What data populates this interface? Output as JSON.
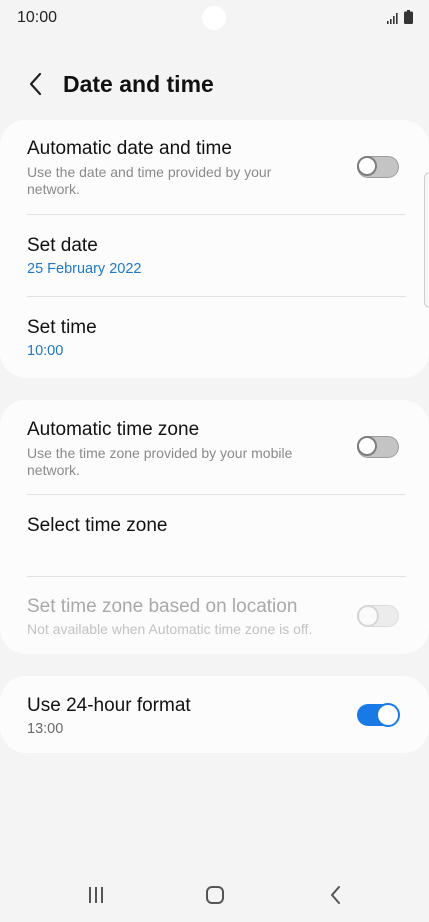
{
  "status_bar": {
    "time": "10:00",
    "icons": [
      "camera-cutout",
      "signal-icon",
      "battery-icon"
    ]
  },
  "header": {
    "back_icon": "chevron-left-icon",
    "title": "Date and time"
  },
  "sections": [
    {
      "items": [
        {
          "title": "Automatic date and time",
          "subtitle": "Use the date and time provided by your network.",
          "toggle": "off"
        },
        {
          "title": "Set date",
          "value": "25 February 2022"
        },
        {
          "title": "Set time",
          "value": "10:00"
        }
      ]
    },
    {
      "items": [
        {
          "title": "Automatic time zone",
          "subtitle": "Use the time zone provided by your mobile network.",
          "toggle": "off"
        },
        {
          "title": "Select time zone"
        },
        {
          "title": "Set time zone based on location",
          "subtitle": "Not available when Automatic time zone is off.",
          "toggle": "disabled"
        }
      ]
    },
    {
      "items": [
        {
          "title": "Use 24-hour format",
          "value": "13:00",
          "toggle": "on"
        }
      ]
    }
  ],
  "nav_bar": {
    "icons": [
      "recent-apps-icon",
      "home-icon",
      "back-icon"
    ]
  },
  "colors": {
    "accent": "#1a7ae5",
    "link_value": "#1e78c8",
    "background": "#f4f4f4",
    "card": "#fcfcfc"
  }
}
